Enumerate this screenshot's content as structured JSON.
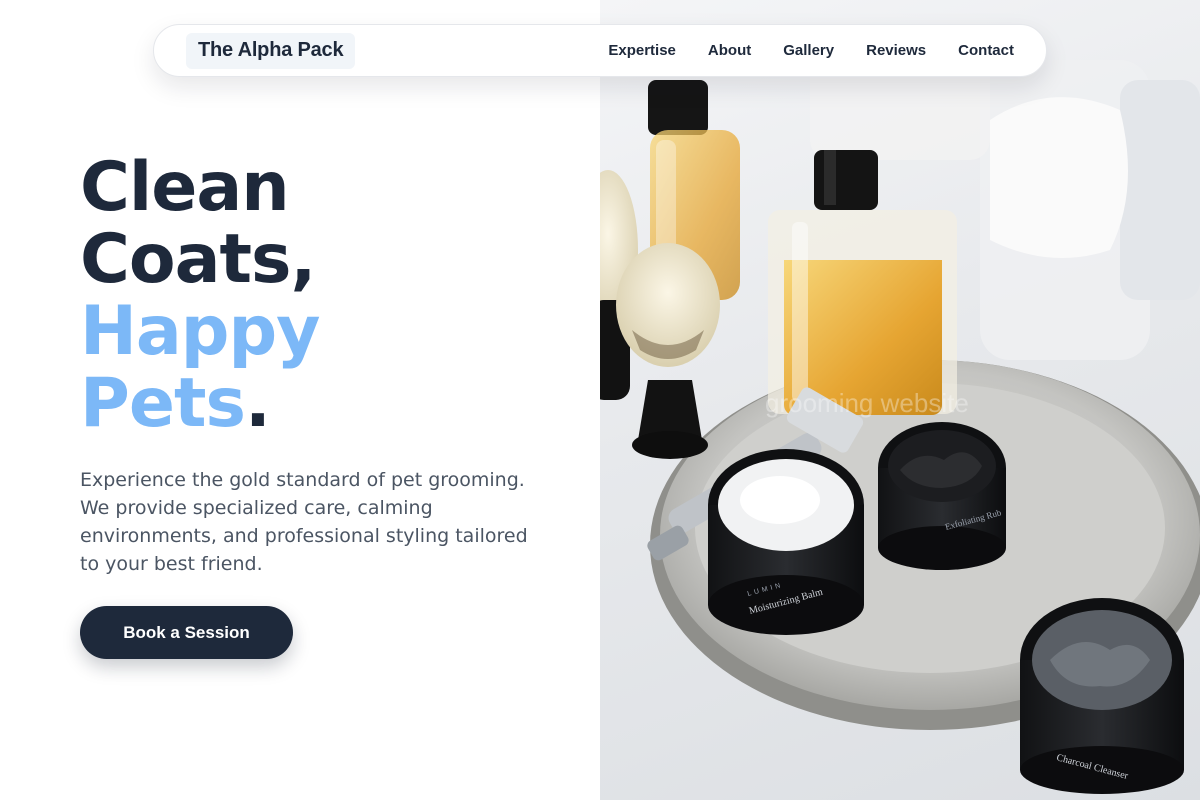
{
  "brand": {
    "name": "The Alpha Pack"
  },
  "nav": {
    "links": [
      "Expertise",
      "About",
      "Gallery",
      "Reviews",
      "Contact"
    ]
  },
  "hero": {
    "line1": "Clean",
    "line2": "Coats,",
    "line3": "Happy",
    "line4": "Pets",
    "line4_dot": ".",
    "description": "Experience the gold standard of pet grooming. We provide specialized care, calming environments, and professional styling tailored to your best friend.",
    "cta_label": "Book a Session"
  },
  "image": {
    "jar_brand": "LUMIN",
    "products": [
      "Moisturizing Balm",
      "Exfoliating Rub",
      "Charcoal Cleanser"
    ],
    "watermark": "grooming website"
  },
  "colors": {
    "primary_dark": "#1e293b",
    "accent_blue": "#7cb8f7",
    "body_text": "#4b5563"
  }
}
